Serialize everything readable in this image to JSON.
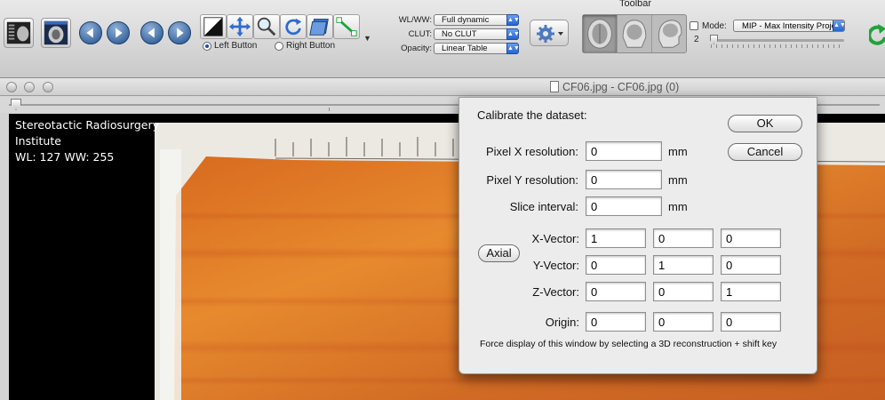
{
  "toolbar": {
    "title": "Toolbar",
    "mouse_buttons": {
      "left": "Left Button",
      "right": "Right Button"
    },
    "wlww": {
      "label": "WL/WW:",
      "value": "Full dynamic"
    },
    "clut": {
      "label": "CLUT:",
      "value": "No CLUT"
    },
    "opacity": {
      "label": "Opacity:",
      "value": "Linear Table"
    },
    "mode": {
      "label": "Mode:",
      "value": "MIP - Max Intensity Projection",
      "thickness": "2"
    }
  },
  "window": {
    "title": "CF06.jpg - CF06.jpg (0)",
    "overlay": {
      "line1": "Stereotactic Radiosurgery",
      "line2": "Institute",
      "wlww": "WL: 127 WW: 255"
    }
  },
  "dialog": {
    "title": "Calibrate the dataset:",
    "ok": "OK",
    "cancel": "Cancel",
    "px_label": "Pixel X resolution:",
    "px_value": "0",
    "py_label": "Pixel Y resolution:",
    "py_value": "0",
    "si_label": "Slice interval:",
    "si_value": "0",
    "unit": "mm",
    "axial": "Axial",
    "xv_label": "X-Vector:",
    "xv": [
      "1",
      "0",
      "0"
    ],
    "yv_label": "Y-Vector:",
    "yv": [
      "0",
      "1",
      "0"
    ],
    "zv_label": "Z-Vector:",
    "zv": [
      "0",
      "0",
      "1"
    ],
    "origin_label": "Origin:",
    "origin": [
      "0",
      "0",
      "0"
    ],
    "hint": "Force display of this window by selecting a 3D reconstruction + shift key"
  },
  "colors": {
    "accent_blue": "#2364d2",
    "image_bg": "#000000",
    "dialog_bg": "#ececec"
  }
}
